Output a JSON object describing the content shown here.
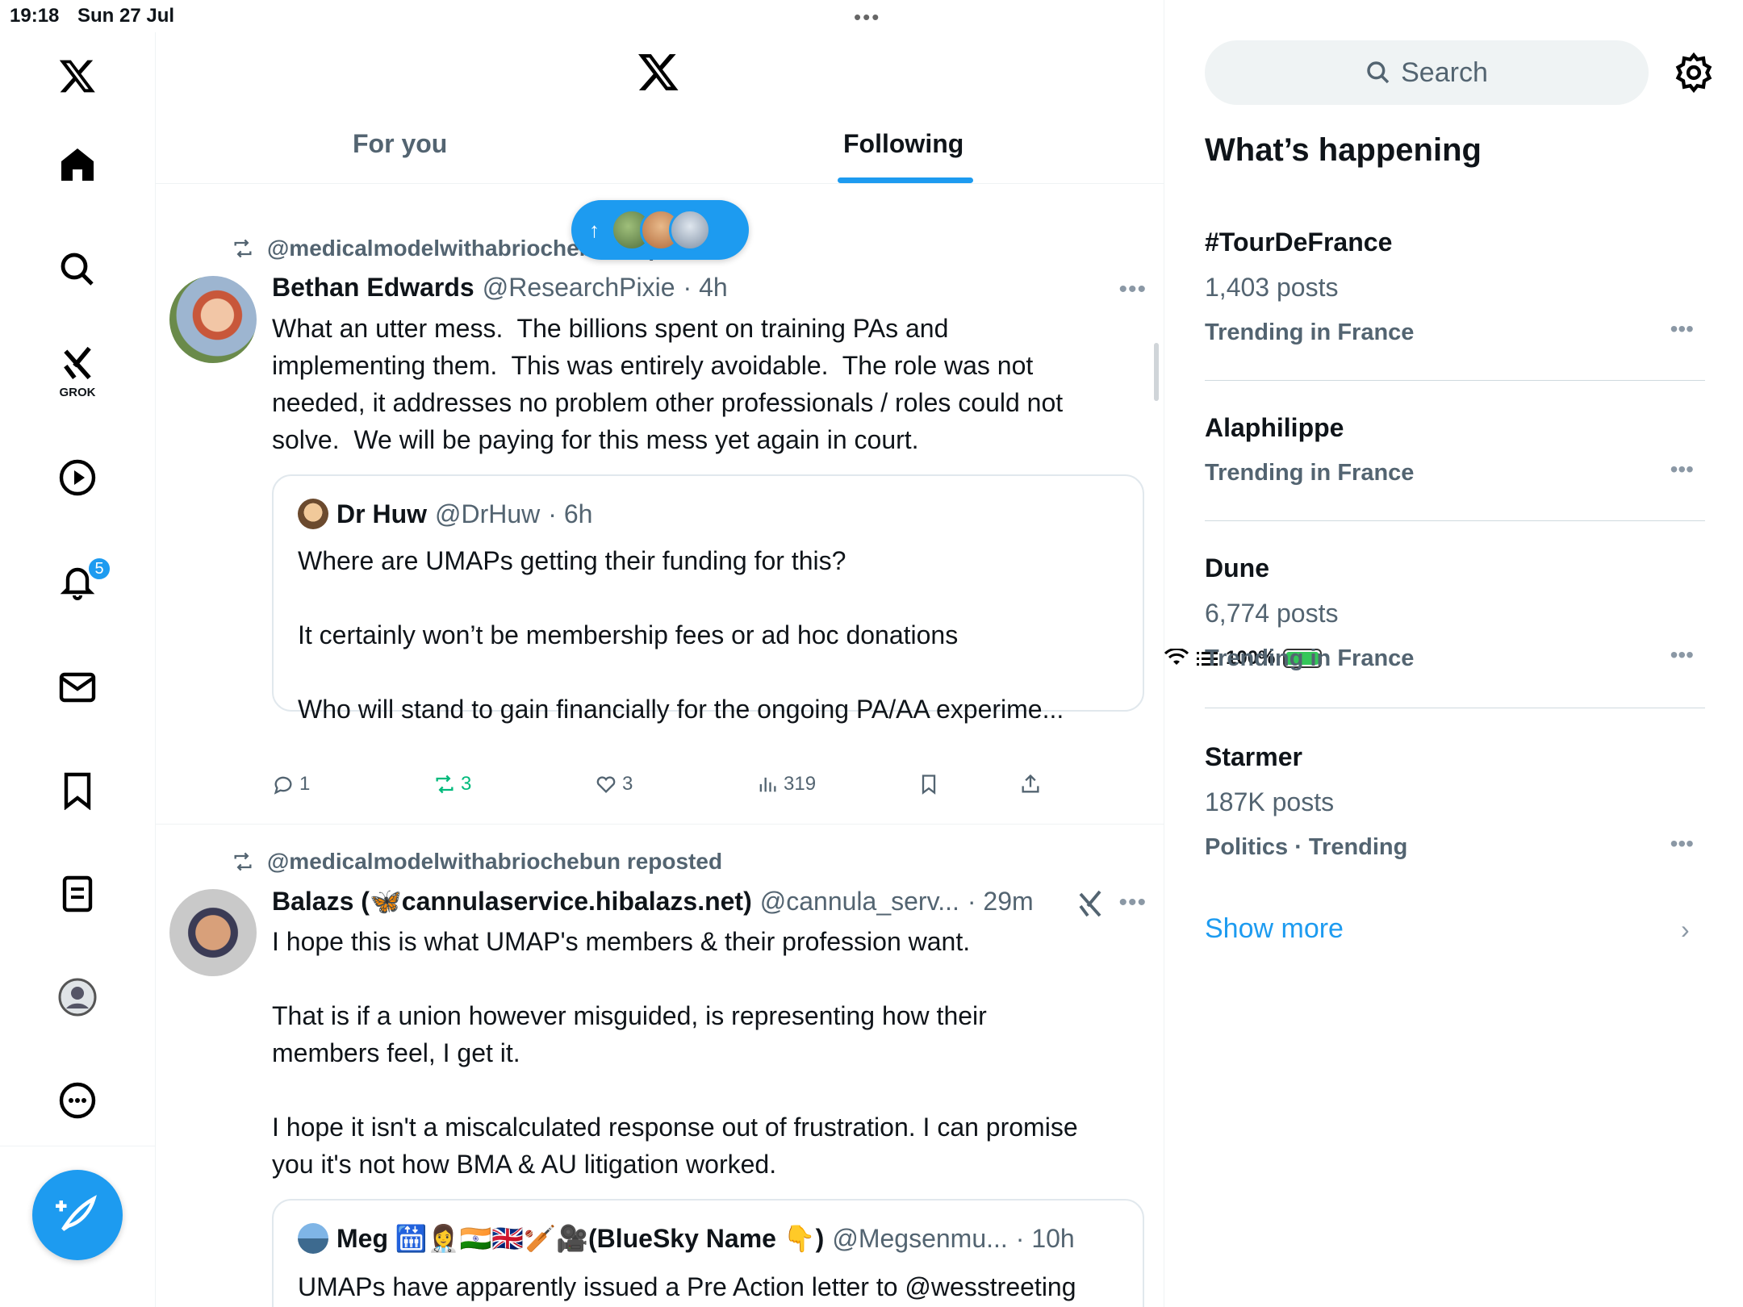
{
  "status_bar": {
    "time": "19:18",
    "date": "Sun 27 Jul",
    "battery": "100%"
  },
  "nav": {
    "grok_label": "GROK",
    "notifications_badge": "5"
  },
  "header": {
    "tabs": [
      {
        "label": "For you"
      },
      {
        "label": "Following"
      }
    ]
  },
  "posts": [
    {
      "repost_label": "@medicalmodelwithabriochebun reposted",
      "name": "Bethan Edwards",
      "handle": "@ResearchPixie",
      "time": "· 4h",
      "text": "What an utter mess.  The billions spent on training PAs and\nimplementing them.  This was entirely avoidable.  The role was not\nneeded, it addresses no problem other professionals / roles could not\nsolve.  We will be paying for this mess yet again in court.",
      "quote": {
        "name": "Dr Huw",
        "handle": "@DrHuw",
        "time": "· 6h",
        "text": "Where are UMAPs getting their funding for this?\n\nIt certainly won’t be membership fees or ad hoc donations\n\nWho will stand to gain financially for the ongoing PA/AA experime..."
      },
      "stats": {
        "replies": "1",
        "reposts": "3",
        "likes": "3",
        "views": "319"
      }
    },
    {
      "repost_label": "@medicalmodelwithabriochebun reposted",
      "name": "Balazs (🦋cannulaservice.hibalazs.net)",
      "handle": "@cannula_serv...",
      "time": "· 29m",
      "text": "I hope this is what UMAP's members & their profession want.\n\nThat is if a union however misguided, is representing how their\nmembers feel, I get it.\n\nI hope it isn't a miscalculated response out of frustration. I can promise\nyou it's not how BMA & AU litigation worked.",
      "quote": {
        "name": "Meg 🛗👩‍⚕️🇮🇳🇬🇧🏏🎥(BlueSky Name 👇)",
        "handle": "@Megsenmu...",
        "time": "· 10h",
        "text": "UMAPs have apparently issued a Pre Action letter to @wesstreeting"
      }
    }
  ],
  "right": {
    "search_placeholder": "Search",
    "section_title": "What’s happening",
    "trends": [
      {
        "name": "#TourDeFrance",
        "count": "1,403 posts",
        "context": "Trending in France"
      },
      {
        "name": "Alaphilippe",
        "count": "",
        "context": "Trending in France"
      },
      {
        "name": "Dune",
        "count": "6,774 posts",
        "context": "Trending in France"
      },
      {
        "name": "Starmer",
        "count": "187K posts",
        "context": "Politics · Trending"
      }
    ],
    "show_more": "Show more"
  },
  "colors": {
    "accent": "#1d9bf0",
    "repost_green": "#00ba7c",
    "secondary_text": "#536471"
  }
}
